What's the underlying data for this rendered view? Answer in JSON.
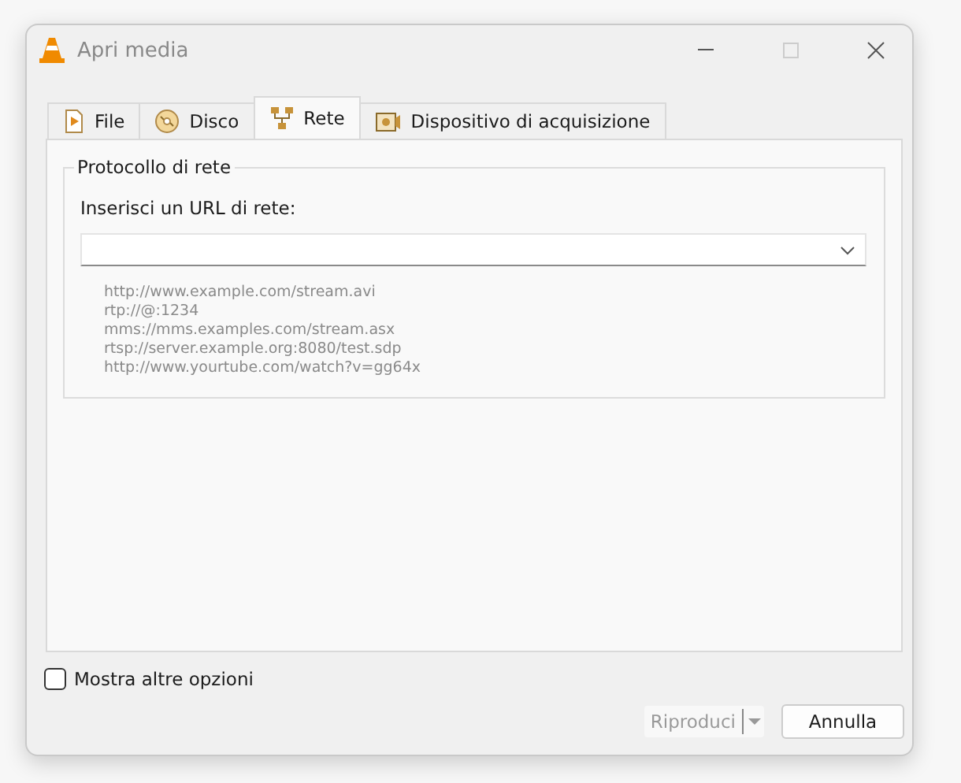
{
  "window": {
    "title": "Apri media"
  },
  "tabs": [
    {
      "label": "File",
      "kind": "file",
      "selected": false
    },
    {
      "label": "Disco",
      "kind": "disc",
      "selected": false
    },
    {
      "label": "Rete",
      "kind": "network",
      "selected": true
    },
    {
      "label": "Dispositivo di acquisizione",
      "kind": "capture",
      "selected": false
    }
  ],
  "network_protocol": {
    "title": "Protocollo di rete",
    "url_label": "Inserisci un URL di rete:",
    "examples": [
      "http://www.example.com/stream.avi",
      "rtp://@:1234",
      "mms://mms.examples.com/stream.asx",
      "rtsp://server.example.org:8080/test.sdp",
      "http://www.yourtube.com/watch?v=gg64x"
    ]
  },
  "more_options": {
    "label": "Mostra altre opzioni",
    "checked": false
  },
  "buttons": [
    {
      "label": "Riproduci",
      "kind": "split",
      "disabled": true
    },
    {
      "label": "Annulla",
      "kind": "plain",
      "disabled": false
    }
  ]
}
